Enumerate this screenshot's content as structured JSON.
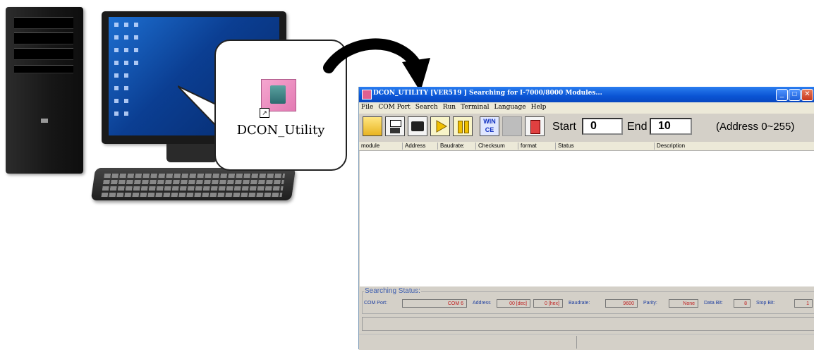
{
  "callout": {
    "label": "DCON_Utility"
  },
  "window": {
    "title": "DCON_UTILITY [VER519 ] Searching for I-7000/8000 Modules...",
    "menu": [
      "File",
      "COM Port",
      "Search",
      "Run",
      "Terminal",
      "Language",
      "Help"
    ],
    "toolbar": {
      "wince_line1": "WIN",
      "wince_line2": "CE",
      "start_label": "Start",
      "start_value": "0",
      "end_label": "End",
      "end_value": "10",
      "range_note": "(Address 0~255)"
    },
    "columns": [
      "module",
      "Address",
      "Baudrate:",
      "Checksum",
      "format",
      "Status",
      "Description"
    ],
    "searching": {
      "legend": "Searching Status:",
      "com_port_label": "COM Port:",
      "com_port_value": "COM 6",
      "address_label": "Address",
      "address_dec": "00 [dec]",
      "address_hex": "0 [hex]",
      "baudrate_label": "Baudrate:",
      "baudrate_value": "9600",
      "parity_label": "Parity:",
      "parity_value": "None",
      "databit_label": "Data Bit:",
      "databit_value": "8",
      "stopbit_label": "Stop Bit:",
      "stopbit_value": "1"
    }
  },
  "icons": [
    "folder-open-icon",
    "save-icon",
    "print-icon",
    "play-icon",
    "pause-icon",
    "wince-icon",
    "blank-icon",
    "module-icon"
  ],
  "colors": {
    "title_blue": "#0a54d4",
    "label_blue": "#2040a0",
    "value_red": "#c02020"
  }
}
